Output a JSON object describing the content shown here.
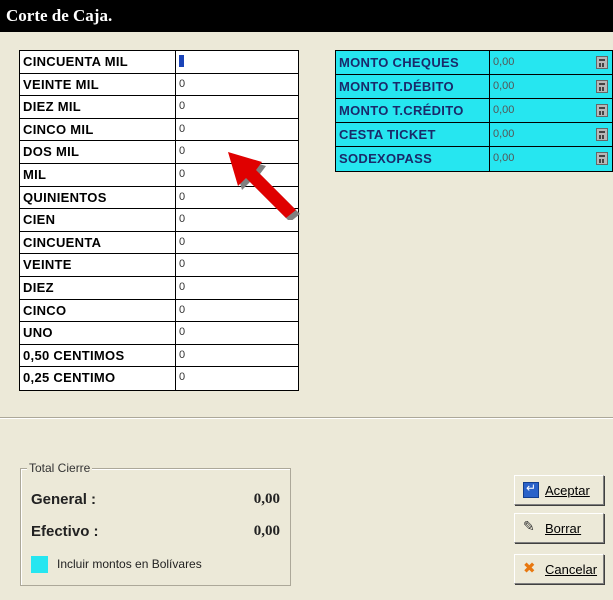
{
  "window": {
    "title": "Corte de Caja."
  },
  "denominations": [
    {
      "label": "CINCUENTA MIL",
      "value": "0"
    },
    {
      "label": "VEINTE MIL",
      "value": "0"
    },
    {
      "label": "DIEZ MIL",
      "value": "0"
    },
    {
      "label": "CINCO MIL",
      "value": "0"
    },
    {
      "label": "DOS MIL",
      "value": "0"
    },
    {
      "label": "MIL",
      "value": "0"
    },
    {
      "label": "QUINIENTOS",
      "value": "0"
    },
    {
      "label": "CIEN",
      "value": "0"
    },
    {
      "label": "CINCUENTA",
      "value": "0"
    },
    {
      "label": "VEINTE",
      "value": "0"
    },
    {
      "label": "DIEZ",
      "value": "0"
    },
    {
      "label": "CINCO",
      "value": "0"
    },
    {
      "label": "UNO",
      "value": "0"
    },
    {
      "label": "0,50 CENTIMOS",
      "value": "0"
    },
    {
      "label": "0,25 CENTIMO",
      "value": "0"
    }
  ],
  "payments": [
    {
      "label": "MONTO CHEQUES",
      "value": "0,00",
      "icon": "calculator-icon"
    },
    {
      "label": "MONTO T.DÉBITO",
      "value": "0,00",
      "icon": "calculator-icon"
    },
    {
      "label": "MONTO T.CRÉDITO",
      "value": "0,00",
      "icon": "calculator-icon"
    },
    {
      "label": "CESTA TICKET",
      "value": "0,00",
      "icon": "calculator-icon"
    },
    {
      "label": "SODEXOPASS",
      "value": "0,00",
      "icon": "calculator-icon"
    }
  ],
  "totals": {
    "group_title": "Total Cierre",
    "general_label": "General :",
    "general_value": "0,00",
    "efectivo_label": "Efectivo :",
    "efectivo_value": "0,00",
    "checkbox_label": "Incluir montos en Bolívares"
  },
  "buttons": {
    "accept_label": "Aceptar",
    "erase_label": "Borrar",
    "cancel_label": "Cancelar"
  },
  "colors": {
    "highlight": "#26e6f0",
    "arrow": "#e00000",
    "titlebar": "#000000"
  }
}
